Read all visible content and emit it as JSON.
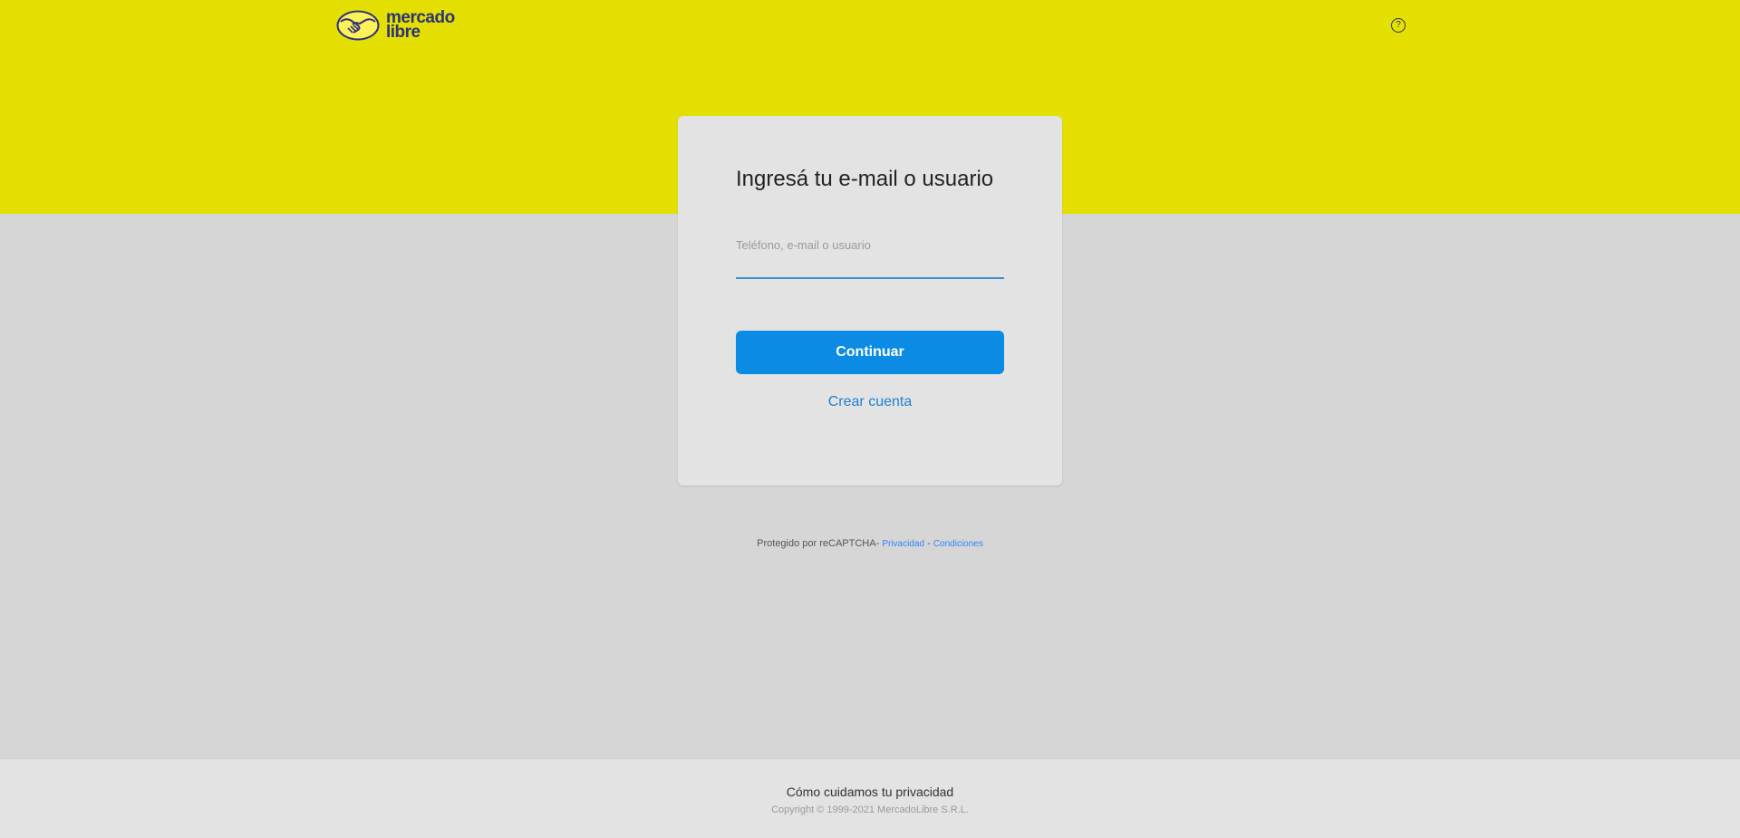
{
  "header": {
    "logo_line1": "mercado",
    "logo_line2": "libre",
    "help_icon": "question-circle-icon",
    "background": "#e3e000"
  },
  "login": {
    "title": "Ingresá tu e-mail o usuario",
    "field_label": "Teléfono, e-mail o usuario",
    "field_value": "",
    "continue_label": "Continuar",
    "create_account_label": "Crear cuenta",
    "accent": "#0a8ce5"
  },
  "recaptcha": {
    "text": "Protegido por reCAPTCHA",
    "sep1": "- ",
    "privacy_link": "Privacidad",
    "sep2": " - ",
    "terms_link": "Condiciones"
  },
  "footer": {
    "privacy_link": "Cómo cuidamos tu privacidad",
    "copyright": "Copyright © 1999-2021 MercadoLibre S.R.L."
  }
}
